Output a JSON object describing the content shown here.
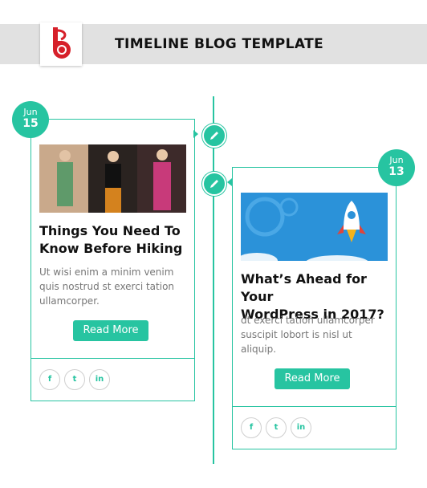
{
  "header": {
    "title": "TIMELINE BLOG TEMPLATE",
    "logo_icon": "brand-logo"
  },
  "colors": {
    "accent": "#27c4a1",
    "header_bg": "#e1e1e1",
    "logo_red": "#d6202a"
  },
  "posts": [
    {
      "date_month": "Jun",
      "date_day": "15",
      "title_line1": "Things You Need To",
      "title_line2": "Know Before Hiking",
      "excerpt_line1": "Ut wisi enim a minim venim",
      "excerpt_line2": "quis nostrud st exerci tation",
      "excerpt_line3": "ullamcorper.",
      "button_label": "Read More",
      "social": [
        "f",
        "t",
        "in"
      ]
    },
    {
      "date_month": "Jun",
      "date_day": "13",
      "title_line1": "What’s Ahead for Your",
      "title_line2": "WordPress in 2017?",
      "excerpt_line1": "dt exerci tation ullamcorper",
      "excerpt_line2": "suscipit lobort is nisl ut",
      "excerpt_line3": "aliquip.",
      "button_label": "Read More",
      "social": [
        "f",
        "t",
        "in"
      ]
    }
  ]
}
